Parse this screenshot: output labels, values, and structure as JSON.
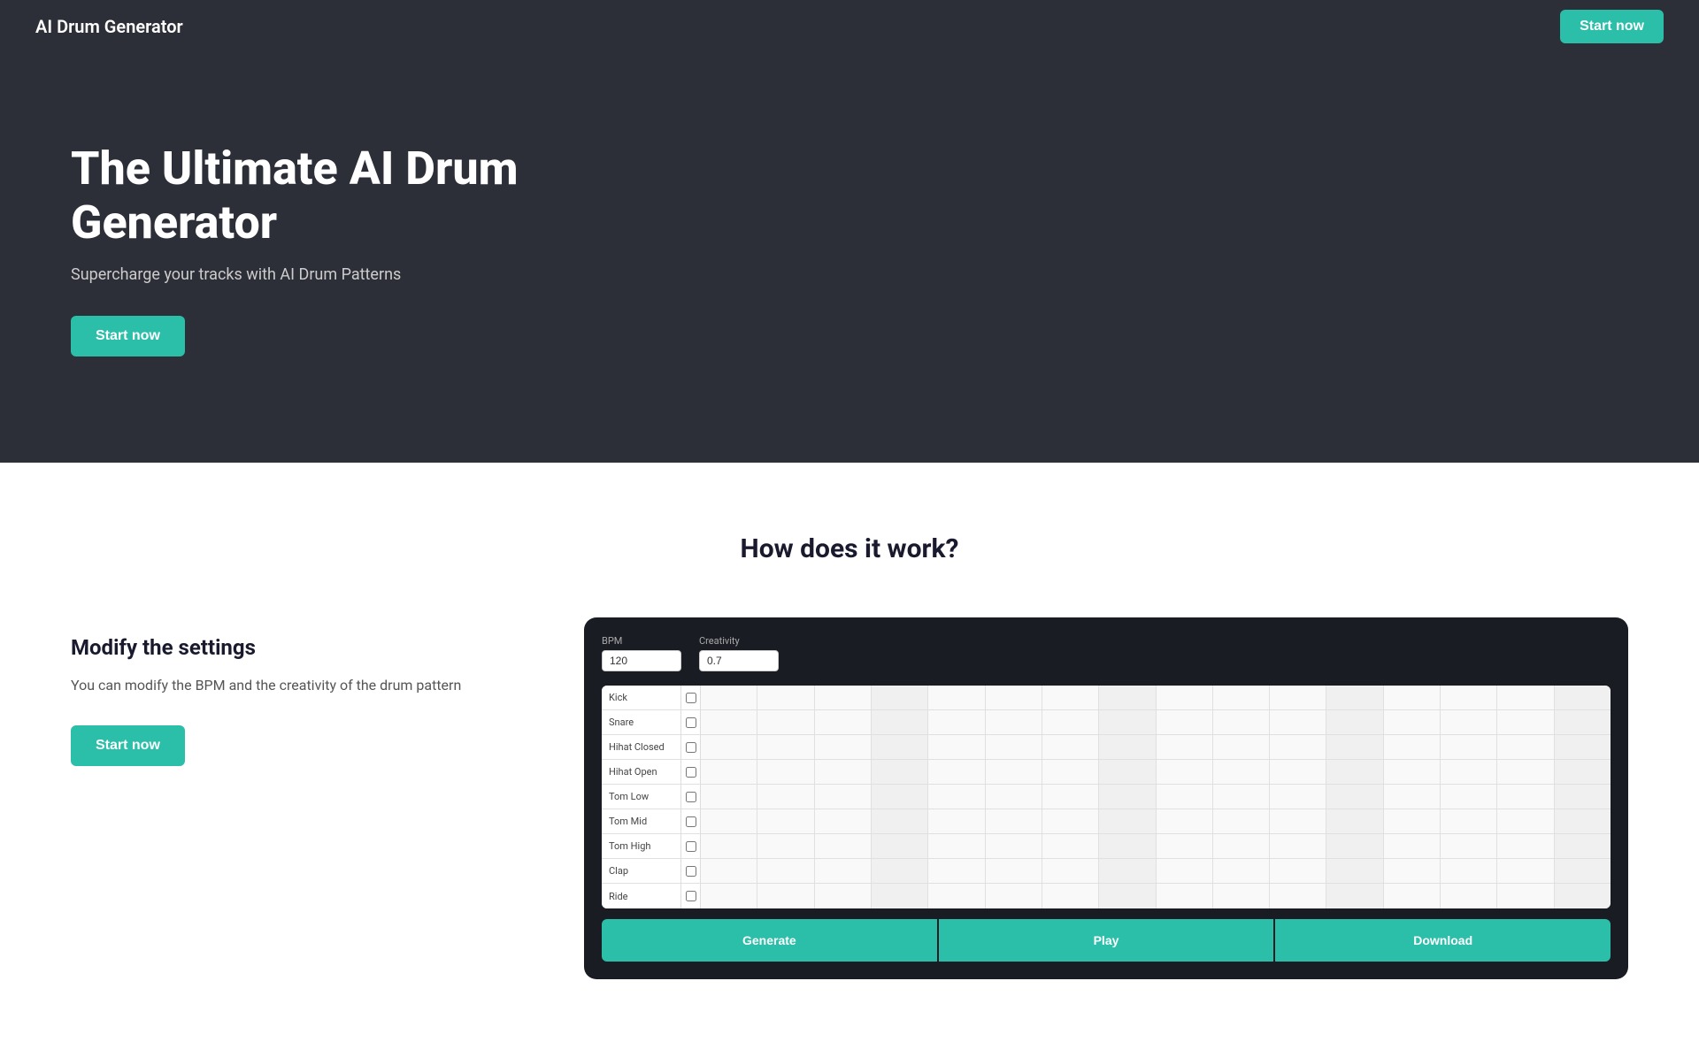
{
  "navbar": {
    "brand": "AI Drum Generator",
    "cta_label": "Start now"
  },
  "hero": {
    "title": "The Ultimate AI Drum Generator",
    "subtitle": "Supercharge your tracks with AI Drum Patterns",
    "cta_label": "Start now"
  },
  "how_section": {
    "title": "How does it work?",
    "feature": {
      "title": "Modify the settings",
      "description": "You can modify the BPM and the creativity of the drum pattern",
      "cta_label": "Start now"
    },
    "mockup": {
      "bpm_label": "BPM",
      "bpm_value": "120",
      "creativity_label": "Creativity",
      "creativity_value": "0.7",
      "drum_rows": [
        "Kick",
        "Snare",
        "Hihat Closed",
        "Hihat Open",
        "Tom Low",
        "Tom Mid",
        "Tom High",
        "Clap",
        "Ride"
      ],
      "btn_generate": "Generate",
      "btn_play": "Play",
      "btn_download": "Download"
    }
  }
}
